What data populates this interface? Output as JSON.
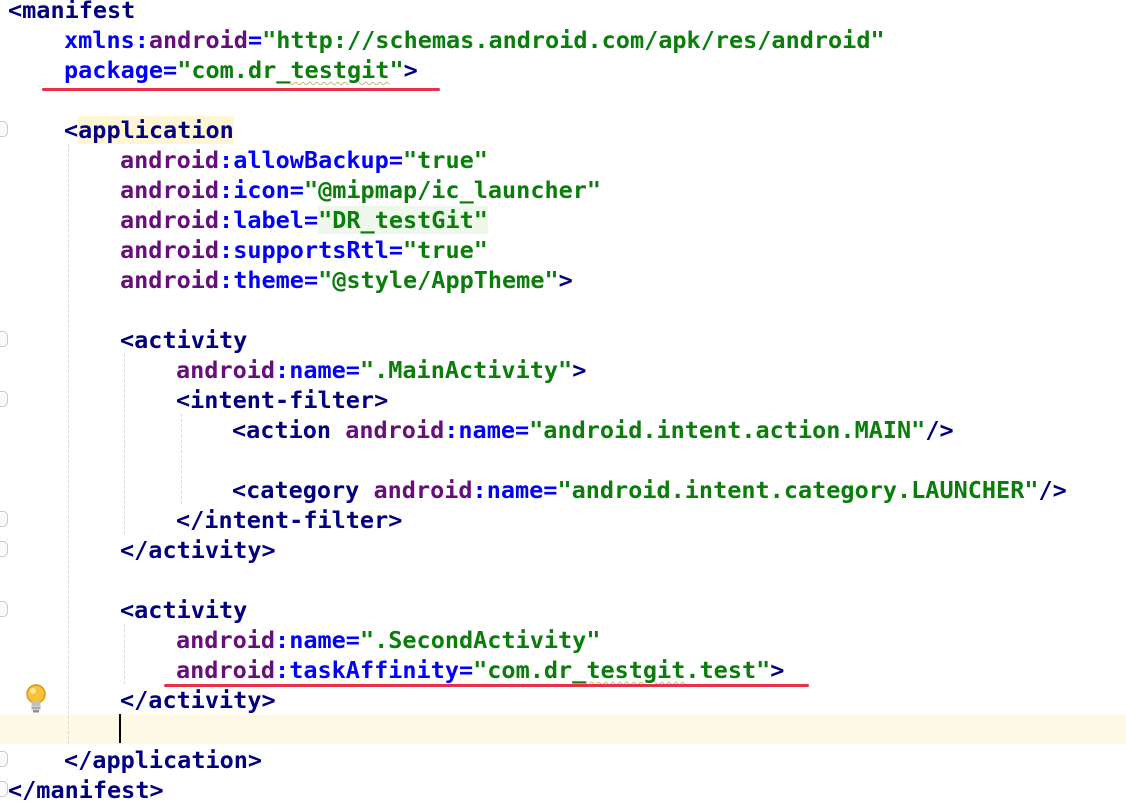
{
  "code": {
    "manifest_open": "<manifest",
    "xmlns": {
      "prefix": "xmlns:",
      "name": "android",
      "eq": "=",
      "value": "\"http://schemas.android.com/apk/res/android\""
    },
    "package": {
      "name": "package",
      "eq": "=",
      "value_open": "\"",
      "value_main": "com.dr_",
      "value_squiggle": "testgit",
      "value_close": "\"",
      "close": ">"
    },
    "application_lt": "<",
    "application_tag": "application",
    "app_attrs": [
      {
        "prefix": "android",
        "colon": ":",
        "name": "allowBackup",
        "eq": "=",
        "value": "\"true\""
      },
      {
        "prefix": "android",
        "colon": ":",
        "name": "icon",
        "eq": "=",
        "value": "\"@mipmap/ic_launcher\""
      },
      {
        "prefix": "android",
        "colon": ":",
        "name": "label",
        "eq": "=",
        "value": "\"DR_testGit\""
      },
      {
        "prefix": "android",
        "colon": ":",
        "name": "supportsRtl",
        "eq": "=",
        "value": "\"true\""
      },
      {
        "prefix": "android",
        "colon": ":",
        "name": "theme",
        "eq": "=",
        "value": "\"@style/AppTheme\"",
        "close": ">"
      }
    ],
    "activity_open": "<activity",
    "main_activity_name": {
      "prefix": "android",
      "colon": ":",
      "name": "name",
      "eq": "=",
      "value": "\".MainActivity\"",
      "close": ">"
    },
    "intent_filter_open": "<intent-filter>",
    "action_line": {
      "open": "<action",
      "prefix": "android",
      "colon": ":",
      "name": "name",
      "eq": "=",
      "value": "\"android.intent.action.MAIN\"",
      "close": "/>"
    },
    "category_line": {
      "open": "<category",
      "prefix": "android",
      "colon": ":",
      "name": "name",
      "eq": "=",
      "value": "\"android.intent.category.LAUNCHER\"",
      "close": "/>"
    },
    "intent_filter_close": "</intent-filter>",
    "activity_close": "</activity>",
    "second_activity_name": {
      "prefix": "android",
      "colon": ":",
      "name": "name",
      "eq": "=",
      "value": "\".SecondActivity\""
    },
    "task_affinity": {
      "prefix": "android",
      "colon": ":",
      "name": "taskAffinity",
      "eq": "=",
      "value_main": "\"com.dr_",
      "value_squiggle": "testgit",
      "value_end": ".test\"",
      "close": ">"
    },
    "application_close": "</application>",
    "manifest_close": "</manifest>"
  },
  "colors": {
    "tag": "#000080",
    "attribute": "#660e7a",
    "value": "#0a7d0a",
    "namespace": "#0000ff",
    "annotation_underline": "#e8304a",
    "current_line": "#fffae6"
  },
  "icons": [
    "fold-marker-icon",
    "lightbulb-icon"
  ]
}
